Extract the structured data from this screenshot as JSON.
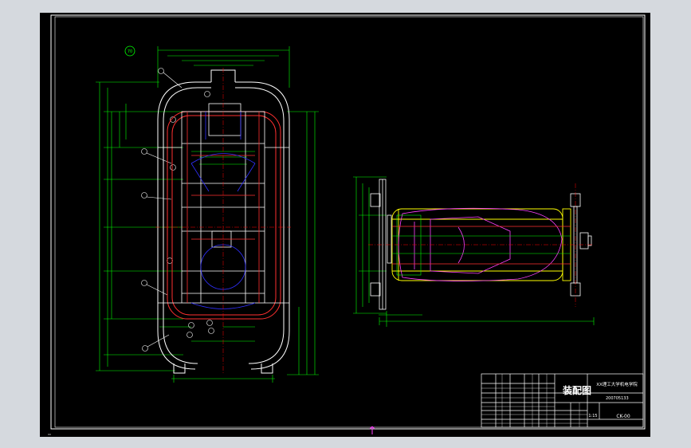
{
  "title_block": {
    "drawing_title": "装配图",
    "school": "XX理工大学机电学院",
    "drawing_number": "CK-00",
    "student_id": "200705133",
    "scale": "1:15"
  },
  "views": {
    "left": {
      "balloon_ref": "70"
    },
    "right": {}
  },
  "colors": {
    "background": "#000000",
    "frame": "#ffffff",
    "structure": "#ffffff",
    "members": "#ff3030",
    "dimensions": "#00ff00",
    "vehicle": "#ff40ff",
    "platform": "#ffff00",
    "hidden": "#3030ff",
    "centerline": "#ff0000"
  },
  "icons": {
    "ucs": "ucs-arrow-icon",
    "cursor": "cursor-icon"
  }
}
